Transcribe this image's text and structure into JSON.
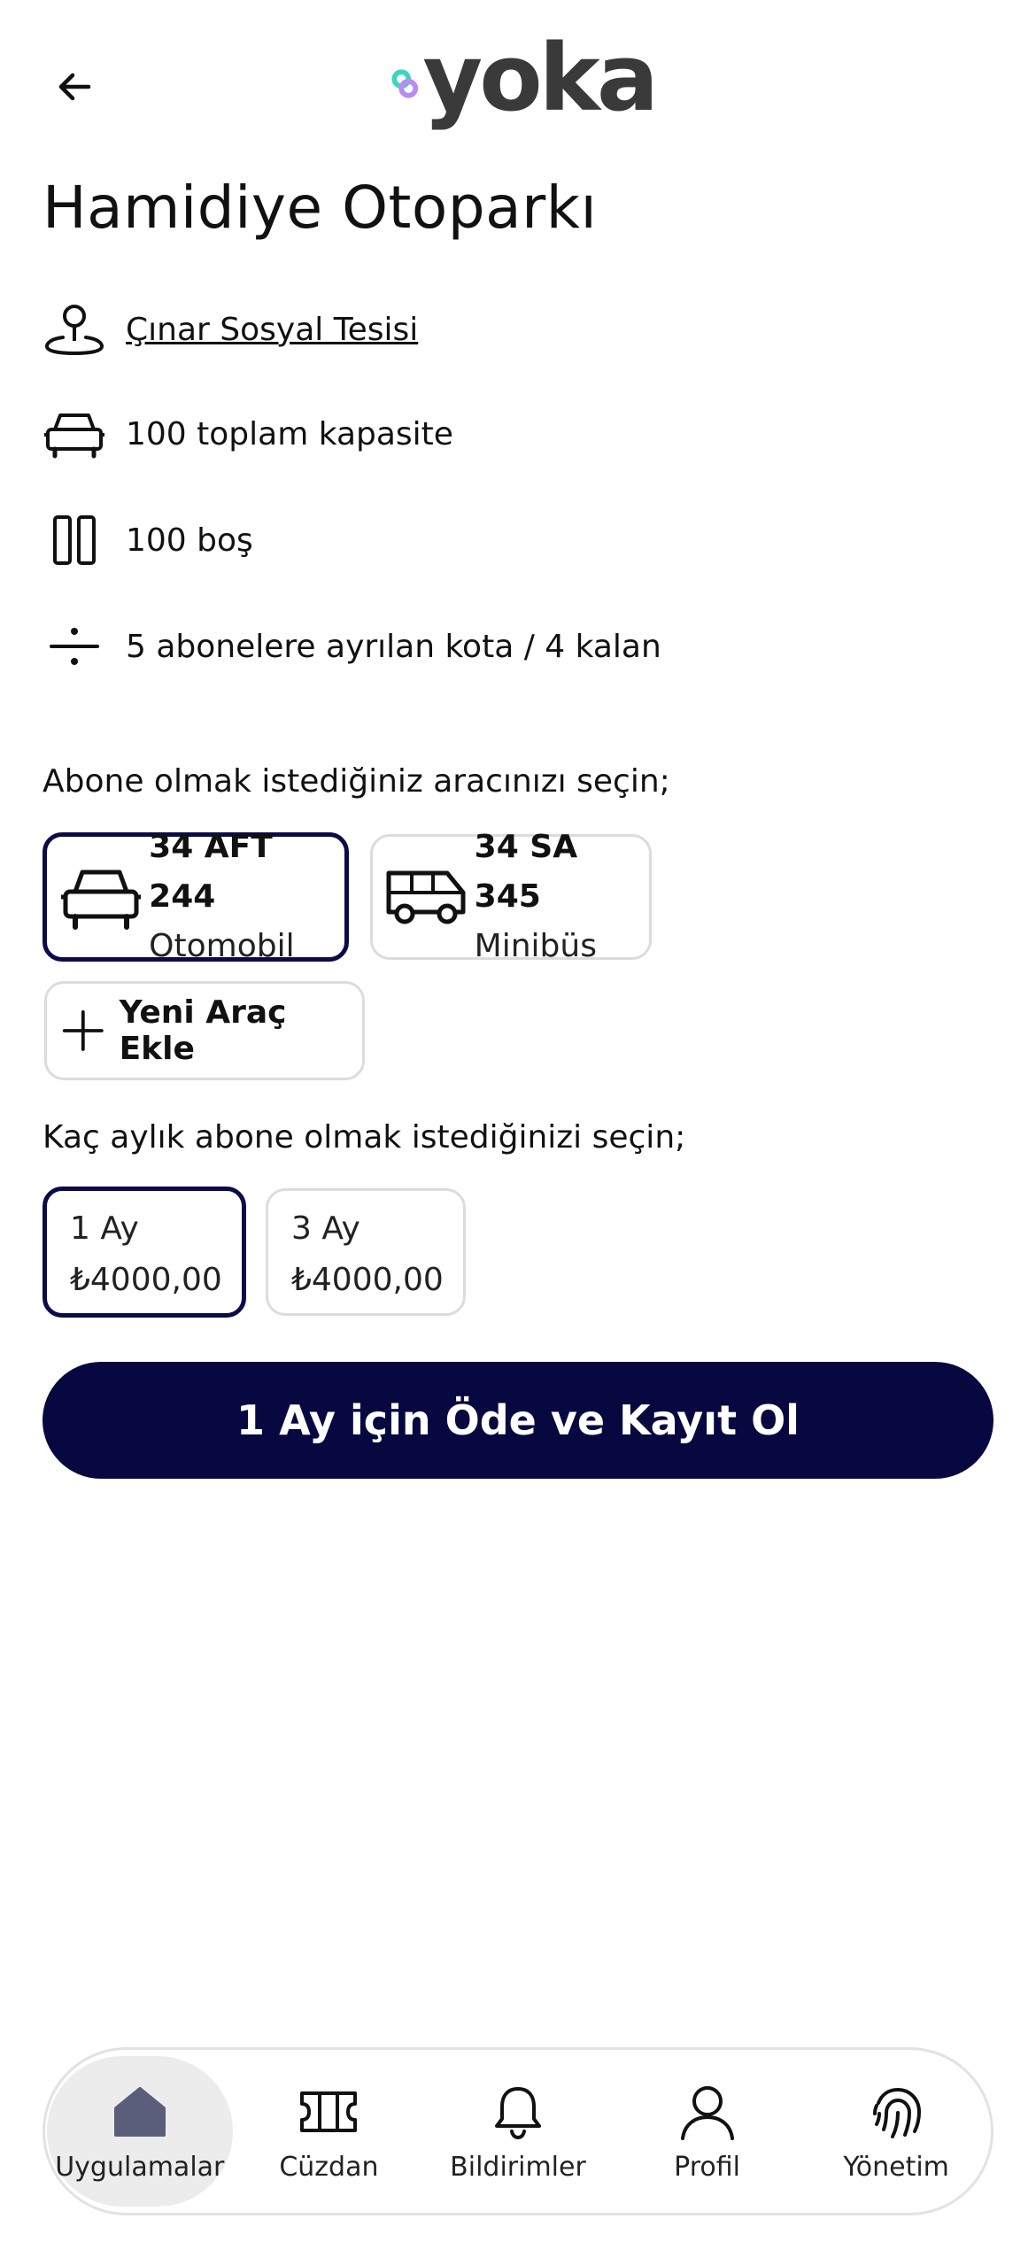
{
  "header": {
    "brand": "yoka"
  },
  "title": "Hamidiye Otoparkı",
  "info": {
    "location": "Çınar Sosyal Tesisi",
    "capacity": "100 toplam kapasite",
    "empty": "100 boş",
    "quota": "5 abonelere ayrılan kota / 4 kalan"
  },
  "vehicle_section": {
    "label": "Abone olmak istediğiniz aracınızı seçin;",
    "vehicles": [
      {
        "plate": "34 AFT 244",
        "type": "Otomobil",
        "icon": "car-icon",
        "selected": true
      },
      {
        "plate": "34 SA 345",
        "type": "Minibüs",
        "icon": "minibus-icon",
        "selected": false
      }
    ],
    "add_label": "Yeni Araç Ekle"
  },
  "plan_section": {
    "label": "Kaç aylık abone olmak istediğinizi seçin;",
    "plans": [
      {
        "name": "1 Ay",
        "price": "₺4000,00",
        "selected": true
      },
      {
        "name": "3 Ay",
        "price": "₺4000,00",
        "selected": false
      }
    ]
  },
  "pay_button": "1 Ay için Öde ve Kayıt Ol",
  "bottom_nav": [
    {
      "label": "Uygulamalar",
      "icon": "home-icon",
      "active": true
    },
    {
      "label": "Cüzdan",
      "icon": "ticket-icon",
      "active": false
    },
    {
      "label": "Bildirimler",
      "icon": "bell-icon",
      "active": false
    },
    {
      "label": "Profil",
      "icon": "user-icon",
      "active": false
    },
    {
      "label": "Yönetim",
      "icon": "fingerprint-icon",
      "active": false
    }
  ],
  "colors": {
    "primary": "#07083f",
    "selected_border": "#0b0c47",
    "logo_teal": "#3fd4c2",
    "logo_purple": "#b98cf0",
    "logo_text": "#3a3a3a"
  }
}
